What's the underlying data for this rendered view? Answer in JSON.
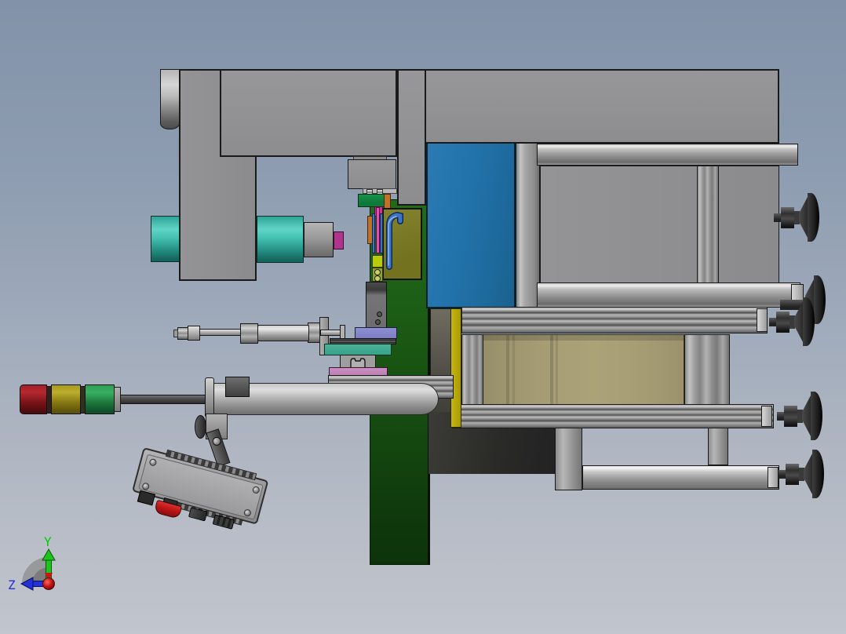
{
  "scene": {
    "app": "3d-cad-viewport",
    "description": "Side view of an automated press / assembly machine 3D model lying rotated 90 degrees: gray C-frame press column with teal spindle, olive tool panel, green backing plate, blue equipment panel, aluminum-extrusion table frame with five dark leveling feet, pneumatic cylinder on a linear stage, tri-color signal tower on a boom tube, and a gray control pendant with red emergency stop"
  },
  "triad": {
    "y_label": "Y",
    "z_label": "Z",
    "y_color": "#00cc00",
    "z_color": "#2431d8",
    "x_color": "#c81616",
    "arc_color": "#8e8e8e"
  },
  "palette": {
    "background_top": "#8292a8",
    "background_bottom": "#c1c5cd",
    "frame_gray": "#919193",
    "panel_blue": "#2172aa",
    "panel_olive": "#72721f",
    "plate_green": "#1c5d15",
    "box_tan": "#a59c74",
    "strip_yellow": "#a99a07",
    "cylinder_teal": "#41bdae",
    "tip_magenta": "#b0338e",
    "stage_teal": "#3aa189",
    "slide_purple": "#7e7ec4",
    "bar_pink": "#bd7fb4",
    "accent_orange": "#bf7227",
    "accent_green": "#0e7a3a",
    "rod_blue": "#3f74c4",
    "rod_pink": "#e050b0",
    "light_red": "#a02028",
    "light_yellow": "#a89a20",
    "light_green": "#2f9e55",
    "estop_red": "#c01818",
    "foot_dark": "#2a2a2a"
  }
}
